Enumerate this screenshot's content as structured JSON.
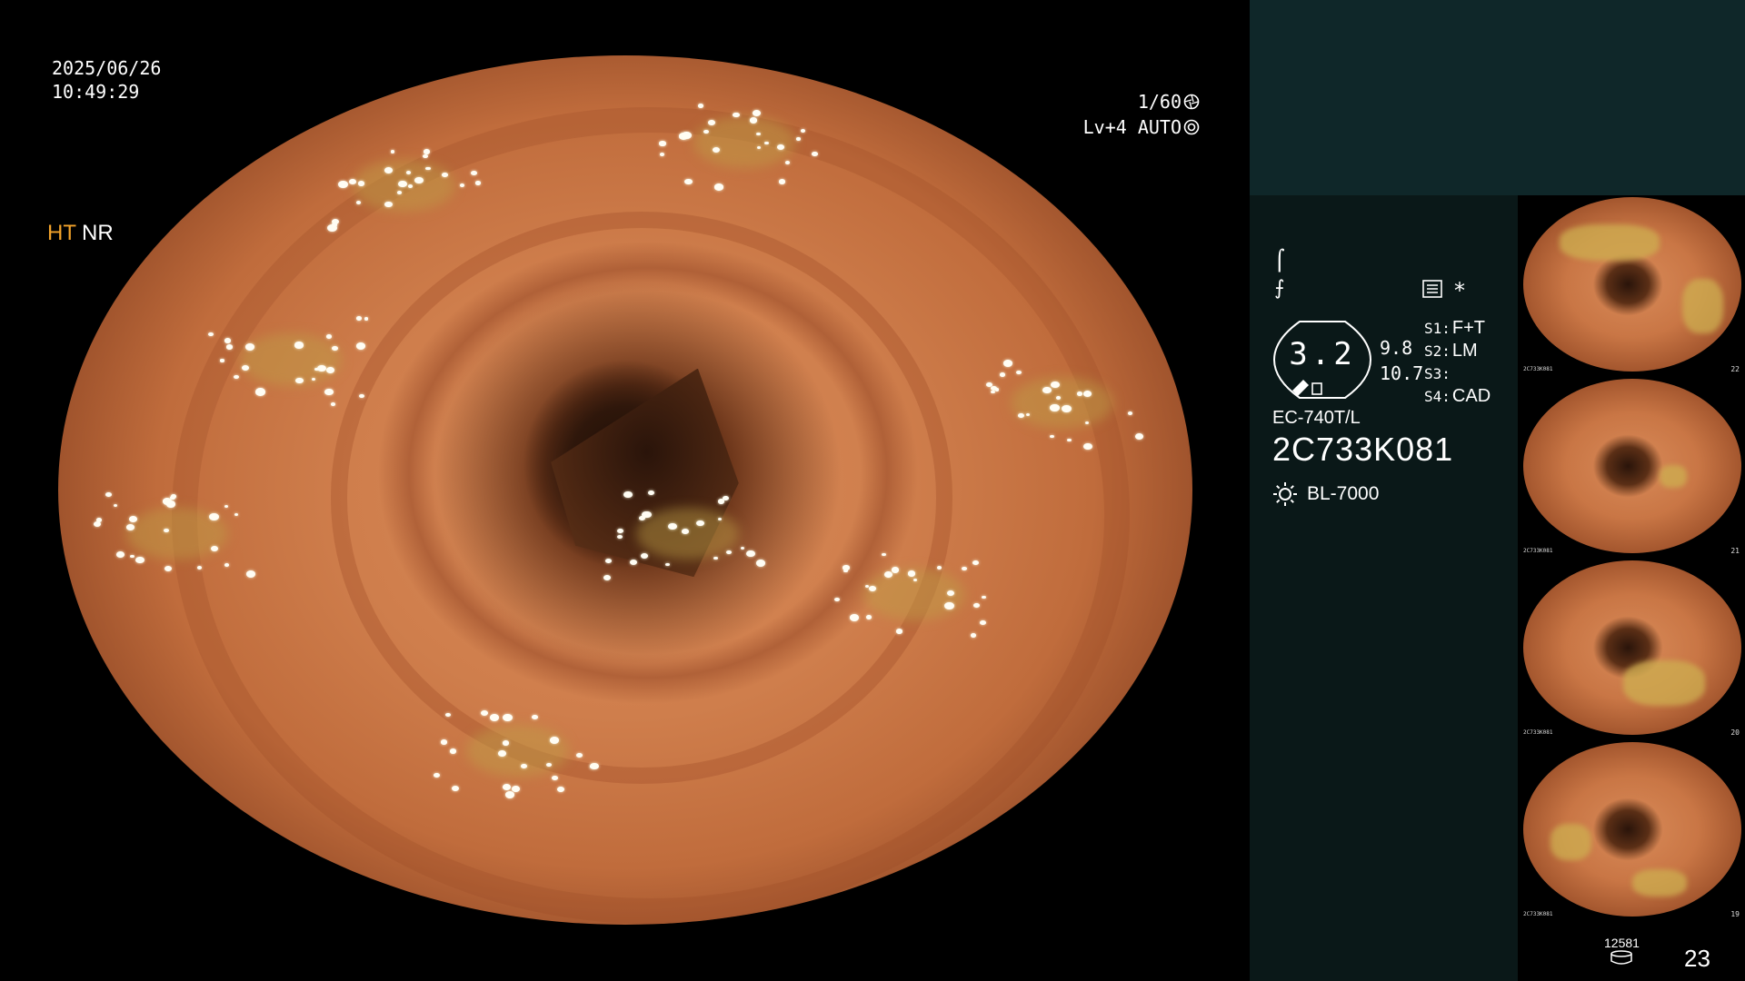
{
  "overlay": {
    "date": "2025/06/26",
    "time": "10:49:29",
    "shutter": "1/60",
    "shutter_icon": "shutter-icon",
    "level": "Lv+4 AUTO",
    "iris_icon": "iris-icon"
  },
  "panel": {
    "mode_ht": "HT",
    "mode_nr": "NR",
    "colors": {
      "ht": "#f2a22a",
      "panel_top": "#0f2729",
      "panel_info": "#0a1818"
    },
    "glyph_1": "⌠",
    "glyph_2": "⨍",
    "asterisk": "*",
    "gauge_value": "3.2",
    "gauge_sub_1": "9.8",
    "gauge_sub_2": "10.7",
    "settings": [
      {
        "key": "S1:",
        "value": "F+T"
      },
      {
        "key": "S2:",
        "value": "LM"
      },
      {
        "key": "S3:",
        "value": ""
      },
      {
        "key": "S4:",
        "value": "CAD"
      }
    ],
    "model": "EC-740T/L",
    "serial": "2C733K081",
    "light_source": "BL-7000",
    "light_icon": "sun-icon"
  },
  "thumbnails": [
    {
      "number": "22",
      "serial": "2C733K081"
    },
    {
      "number": "21",
      "serial": "2C733K081"
    },
    {
      "number": "20",
      "serial": "2C733K081"
    },
    {
      "number": "19",
      "serial": "2C733K081"
    }
  ],
  "footer": {
    "storage_count": "12581",
    "storage_icon": "database-icon",
    "frame_counter": "23"
  }
}
